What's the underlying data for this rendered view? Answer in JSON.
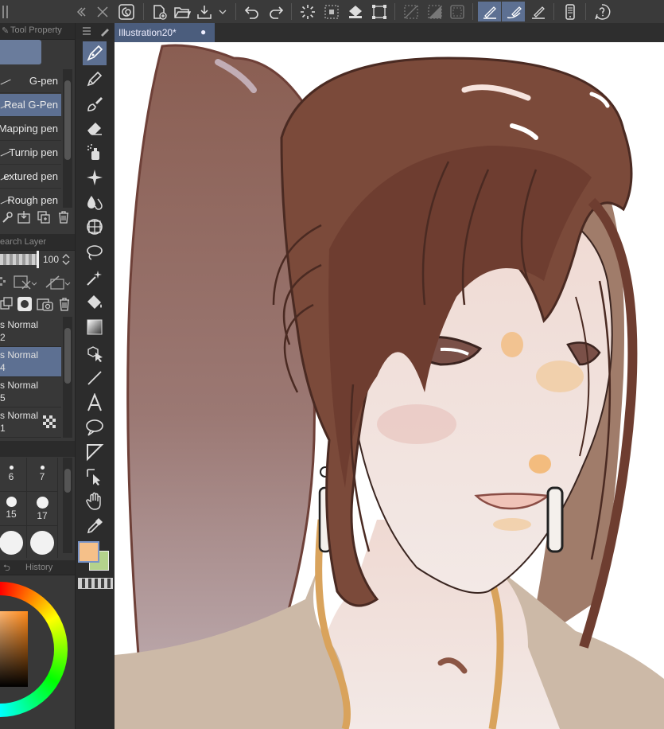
{
  "toolbar": {
    "items": [
      "clip-studio-icon",
      "new-file-icon",
      "open-folder-icon",
      "save-icon",
      "dropdown-chevron-icon",
      "undo-icon",
      "redo-icon",
      "loading-spinner-icon",
      "clear-icon",
      "fill-icon",
      "transform-icon",
      "select-none-icon",
      "invert-selection-icon",
      "selection-border-icon",
      "pen-pressure-icon",
      "stabilization-icon",
      "post-correction-icon",
      "smartphone-icon",
      "help-icon"
    ]
  },
  "tool_property": {
    "tab_label": "Tool Property",
    "sub_tools": [
      {
        "label": "G-pen",
        "selected": false
      },
      {
        "label": "Real G-Pen",
        "selected": true
      },
      {
        "label": "Mapping pen",
        "selected": false
      },
      {
        "label": "Turnip pen",
        "selected": false
      },
      {
        "label": "extured pen",
        "selected": false
      },
      {
        "label": "Rough pen",
        "selected": false
      }
    ]
  },
  "layers": {
    "tab_label": "earch Layer",
    "opacity": "100",
    "rows": [
      {
        "mode": "s Normal",
        "name": "2",
        "selected": false
      },
      {
        "mode": "s Normal",
        "name": "4",
        "selected": true
      },
      {
        "mode": "s Normal",
        "name": "5",
        "selected": false
      },
      {
        "mode": "s Normal",
        "name": "1",
        "selected": false
      }
    ]
  },
  "brush_sizes": [
    {
      "value": "6",
      "dot": 5
    },
    {
      "value": "7",
      "dot": 5
    },
    {
      "value": "15",
      "dot": 13
    },
    {
      "value": "17",
      "dot": 15
    },
    {
      "value": "",
      "dot": 30
    },
    {
      "value": "",
      "dot": 30
    }
  ],
  "history": {
    "tab_label": "History"
  },
  "colors": {
    "main": "#f5c089",
    "sub": "#b4d28c",
    "accent": "#5d7092"
  },
  "document": {
    "tab_label": "Illustration20*"
  },
  "tools": [
    "pen-icon",
    "pencil-icon",
    "brush-icon",
    "eraser-icon",
    "airbrush-icon",
    "decoration-sparkle-icon",
    "blend-drops-icon",
    "figure-icon",
    "lasso-icon",
    "magic-wand-icon",
    "fill-bucket-icon",
    "gradient-icon",
    "object-select-icon",
    "line-icon",
    "text-icon",
    "balloon-icon",
    "frame-border-icon",
    "correct-line-icon",
    "hand-icon",
    "eyedropper-icon"
  ]
}
